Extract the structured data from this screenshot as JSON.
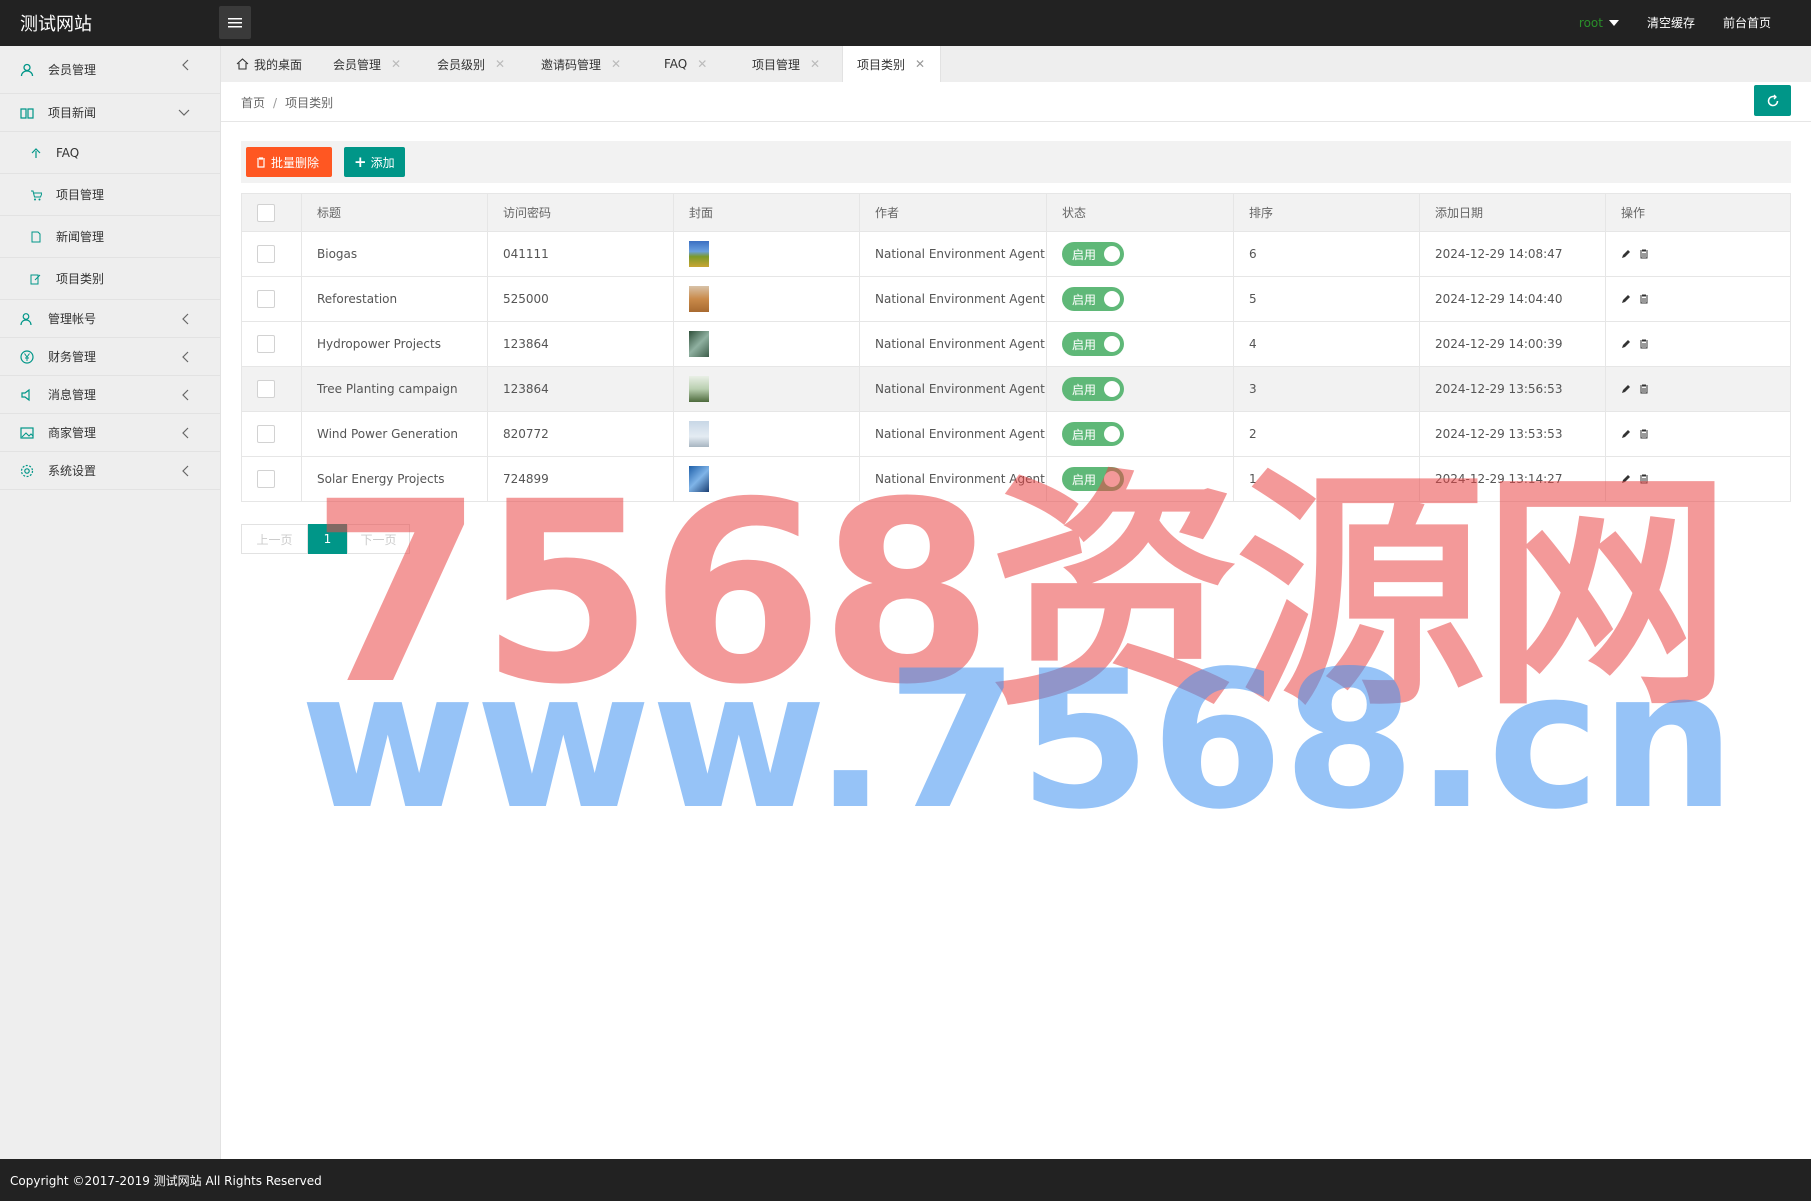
{
  "app": {
    "title": "测试网站"
  },
  "topbar": {
    "user": "root",
    "clear_cache": "清空缓存",
    "frontend_home": "前台首页"
  },
  "sidebar": {
    "items": [
      {
        "label": "会员管理",
        "icon": "user-icon"
      },
      {
        "label": "项目新闻",
        "icon": "book-icon",
        "expanded": true,
        "children": [
          {
            "label": "FAQ",
            "icon": "leaf-icon"
          },
          {
            "label": "项目管理",
            "icon": "cart-icon"
          },
          {
            "label": "新闻管理",
            "icon": "doc-icon"
          },
          {
            "label": "项目类别",
            "icon": "edit-icon"
          }
        ]
      },
      {
        "label": "管理帐号",
        "icon": "users-icon"
      },
      {
        "label": "财务管理",
        "icon": "yen-icon"
      },
      {
        "label": "消息管理",
        "icon": "speaker-icon"
      },
      {
        "label": "商家管理",
        "icon": "image-icon"
      },
      {
        "label": "系统设置",
        "icon": "gear-icon"
      }
    ]
  },
  "tabs": [
    {
      "label": "我的桌面"
    },
    {
      "label": "会员管理"
    },
    {
      "label": "会员级别"
    },
    {
      "label": "邀请码管理"
    },
    {
      "label": "FAQ"
    },
    {
      "label": "项目管理"
    },
    {
      "label": "项目类别",
      "active": true
    }
  ],
  "breadcrumb": {
    "home": "首页",
    "sep": "/",
    "current": "项目类别"
  },
  "toolbar": {
    "batch_delete": "批量删除",
    "add": "添加"
  },
  "table": {
    "headers": [
      "标题",
      "访问密码",
      "封面",
      "作者",
      "状态",
      "排序",
      "添加日期",
      "操作"
    ],
    "rows": [
      {
        "title": "Biogas",
        "password": "041111",
        "author": "National Environment Agent",
        "status": "启用",
        "sort": "6",
        "date": "2024-12-29 14:08:47"
      },
      {
        "title": "Reforestation",
        "password": "525000",
        "author": "National Environment Agent",
        "status": "启用",
        "sort": "5",
        "date": "2024-12-29 14:04:40"
      },
      {
        "title": "Hydropower Projects",
        "password": "123864",
        "author": "National Environment Agent",
        "status": "启用",
        "sort": "4",
        "date": "2024-12-29 14:00:39"
      },
      {
        "title": "Tree Planting campaign",
        "password": "123864",
        "author": "National Environment Agent",
        "status": "启用",
        "sort": "3",
        "date": "2024-12-29 13:56:53"
      },
      {
        "title": "Wind Power Generation",
        "password": "820772",
        "author": "National Environment Agent",
        "status": "启用",
        "sort": "2",
        "date": "2024-12-29 13:53:53"
      },
      {
        "title": "Solar Energy Projects",
        "password": "724899",
        "author": "National Environment Agent",
        "status": "启用",
        "sort": "1",
        "date": "2024-12-29 13:14:27"
      }
    ]
  },
  "pager": {
    "prev": "上一页",
    "current": "1",
    "next": "下一页"
  },
  "footer": {
    "text": "Copyright ©2017-2019 测试网站 All Rights Reserved"
  },
  "watermark": {
    "line1": "7568资源网",
    "line2": "www.7568.cn"
  },
  "colors": {
    "primary": "#009688",
    "danger": "#FF5722",
    "switch_on": "#5FB878",
    "topbar": "#222222"
  }
}
